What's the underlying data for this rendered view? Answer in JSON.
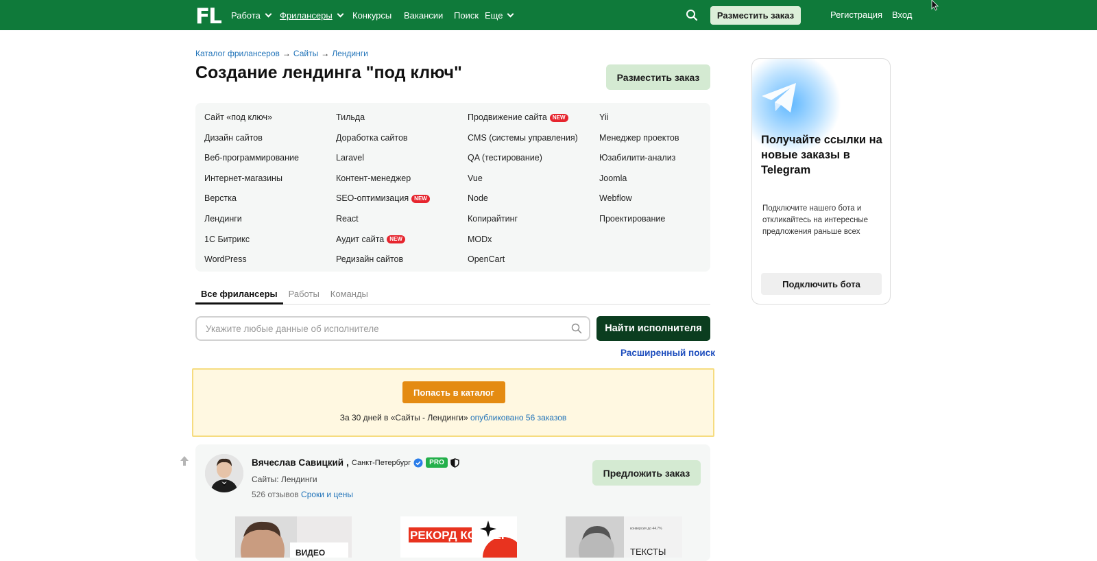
{
  "topbar": {
    "logo": "FL",
    "nav": [
      {
        "label": "Работа",
        "dropdown": true
      },
      {
        "label": "Фрилансеры",
        "dropdown": true,
        "active": true
      },
      {
        "label": "Конкурсы",
        "dropdown": false
      },
      {
        "label": "Вакансии",
        "dropdown": false
      },
      {
        "label": "Поиск",
        "dropdown": false
      },
      {
        "label": "Еще",
        "dropdown": true
      }
    ],
    "order_button": "Разместить заказ",
    "register_link": "Регистрация",
    "login_link": "Вход"
  },
  "breadcrumb": [
    "Каталог фрилансеров",
    "→",
    "Сайты",
    "→",
    "Лендинги"
  ],
  "page_title": "Создание лендинга \"под ключ\"",
  "order_button": "Разместить заказ",
  "categories": {
    "col1": [
      {
        "label": "Сайт «под ключ»"
      },
      {
        "label": "Дизайн сайтов"
      },
      {
        "label": "Веб-программирование"
      },
      {
        "label": "Интернет-магазины"
      },
      {
        "label": "Верстка"
      },
      {
        "label": "Лендинги"
      },
      {
        "label": "1С Битрикс"
      },
      {
        "label": "WordPress"
      }
    ],
    "col2": [
      {
        "label": "Тильда"
      },
      {
        "label": "Доработка сайтов"
      },
      {
        "label": "Laravel"
      },
      {
        "label": "Контент-менеджер"
      },
      {
        "label": "SEO-оптимизация",
        "badge": "NEW"
      },
      {
        "label": "React"
      },
      {
        "label": "Аудит сайта",
        "badge": "NEW"
      },
      {
        "label": "Редизайн сайтов"
      }
    ],
    "col3": [
      {
        "label": "Продвижение сайта",
        "badge": "NEW"
      },
      {
        "label": "CMS (системы управления)"
      },
      {
        "label": "QA (тестирование)"
      },
      {
        "label": "Vue"
      },
      {
        "label": "Node"
      },
      {
        "label": "Копирайтинг"
      },
      {
        "label": "MODx"
      },
      {
        "label": "OpenCart"
      }
    ],
    "col4": [
      {
        "label": "Yii"
      },
      {
        "label": "Менеджер проектов"
      },
      {
        "label": "Юзабилити-анализ"
      },
      {
        "label": "Joomla"
      },
      {
        "label": "Webflow"
      },
      {
        "label": "Проектирование"
      }
    ]
  },
  "tabs": [
    {
      "label": "Все фрилансеры",
      "active": true
    },
    {
      "label": "Работы",
      "active": false
    },
    {
      "label": "Команды",
      "active": false
    }
  ],
  "search": {
    "placeholder": "Укажите любые данные об исполнителе",
    "value": "",
    "button": "Найти исполнителя",
    "advanced_link": "Расширенный поиск"
  },
  "catalog_banner": {
    "button": "Попасть в каталог",
    "text_prefix": "За 30 дней в «Сайты - Лендинги»",
    "text_link": "опубликовано 56 заказов"
  },
  "freelancer": {
    "name": "Вячеслав Савицкий",
    "comma": ",",
    "city": "Санкт-Петербург",
    "pro_label": "PRO",
    "specialization": "Сайты: Лендинги",
    "reviews": "526 отзывов",
    "prices_link": "Сроки и цены",
    "offer_button": "Предложить заказ",
    "portfolio": [
      {
        "caption": "ВИДЕО"
      },
      {
        "caption": "РЕКОРД КОНВЕРСИИ"
      },
      {
        "caption": "ТЕКСТЫ",
        "small_caption": "конверсия до 44.7%"
      }
    ]
  },
  "telegram_promo": {
    "title": "Получайте ссылки на новые заказы в Telegram",
    "text": "Подключите нашего бота и откликайтесь на интересные предложения раньше всех",
    "button": "Подключить бота"
  },
  "colors": {
    "brand_green": "#0f7a3a",
    "dark_green_button": "#0b3d1f",
    "light_green_button": "#d4ead2",
    "catalog_orange": "#e48b12",
    "banner_bg": "#fff8e1",
    "link_blue": "#1f72b8",
    "new_badge_red": "#e6252e",
    "pro_green": "#24b04b"
  }
}
